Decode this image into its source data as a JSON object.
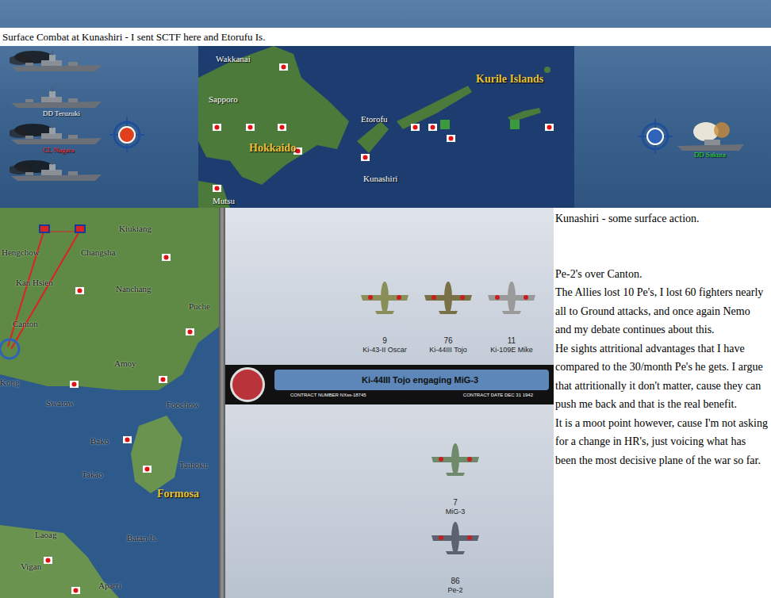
{
  "title_bar": "Surface Combat at Kunashiri - I sent SCTF here and Etorufu Is.",
  "japanese_ships": [
    {
      "label": "",
      "color": "#ffffff",
      "damaged": true
    },
    {
      "label": "DD Teruzuki",
      "color": "#ffffff",
      "damaged": false
    },
    {
      "label": "CL Nagara",
      "color": "#ff2a2a",
      "damaged": true
    },
    {
      "label": "",
      "color": "#ffffff",
      "damaged": true
    }
  ],
  "allied_ship": {
    "label": "DD Sakura",
    "color": "#22dd22",
    "damaged": true
  },
  "north_map": {
    "labels": [
      {
        "text": "Wakkanai",
        "kind": "place"
      },
      {
        "text": "Sapporo",
        "kind": "place"
      },
      {
        "text": "Hokkaido",
        "kind": "region"
      },
      {
        "text": "Etorofu",
        "kind": "place"
      },
      {
        "text": "Kurile Islands",
        "kind": "region"
      },
      {
        "text": "Kunashiri",
        "kind": "place"
      },
      {
        "text": "Mutsu",
        "kind": "place"
      }
    ]
  },
  "china_map": {
    "labels": [
      {
        "text": "Kiukiang",
        "kind": "place"
      },
      {
        "text": "Hengchow",
        "kind": "place"
      },
      {
        "text": "Changsha",
        "kind": "place"
      },
      {
        "text": "Kan Hsien",
        "kind": "place"
      },
      {
        "text": "Nanchang",
        "kind": "place"
      },
      {
        "text": "Canton",
        "kind": "place"
      },
      {
        "text": "Puche",
        "kind": "place"
      },
      {
        "text": "Amoy",
        "kind": "place"
      },
      {
        "text": "Kong",
        "kind": "place"
      },
      {
        "text": "Swatow",
        "kind": "place"
      },
      {
        "text": "Foochow",
        "kind": "place"
      },
      {
        "text": "Bako",
        "kind": "place"
      },
      {
        "text": "Takao",
        "kind": "place"
      },
      {
        "text": "Taihoku",
        "kind": "place"
      },
      {
        "text": "Formosa",
        "kind": "region"
      },
      {
        "text": "Laoag",
        "kind": "place"
      },
      {
        "text": "Batan Is.",
        "kind": "place"
      },
      {
        "text": "Vigan",
        "kind": "place"
      },
      {
        "text": "Aparri",
        "kind": "place"
      }
    ]
  },
  "combat": {
    "attackers": [
      {
        "count": "9",
        "name": "Ki-43-II Oscar"
      },
      {
        "count": "76",
        "name": "Ki-44III Tojo"
      },
      {
        "count": "11",
        "name": "Ki-109E Mike"
      }
    ],
    "banner": {
      "title": "Ki-44III Tojo engaging MiG-3",
      "contract_number": "CONTRACT NUMBER NXss-18745",
      "contract_date": "CONTRACT DATE DEC 31 1942"
    },
    "defenders": [
      {
        "count": "7",
        "name": "MiG-3"
      },
      {
        "count": "86",
        "name": "Pe-2"
      }
    ]
  },
  "paragraphs": [
    "Kunashiri - some surface action.",
    "Pe-2's over Canton.\nThe Allies lost 10 Pe's, I lost 60 fighters nearly all to Ground attacks, and once again Nemo and my debate continues about this.\nHe sights attritional advantages that I have compared to the 30/month Pe's he gets. I argue that attritionally it don't matter, cause they can push me back and that is the real benefit.\nIt is a moot point however, cause I'm not asking for a change in HR's, just voicing what has been the most decisive plane of the war so far."
  ]
}
